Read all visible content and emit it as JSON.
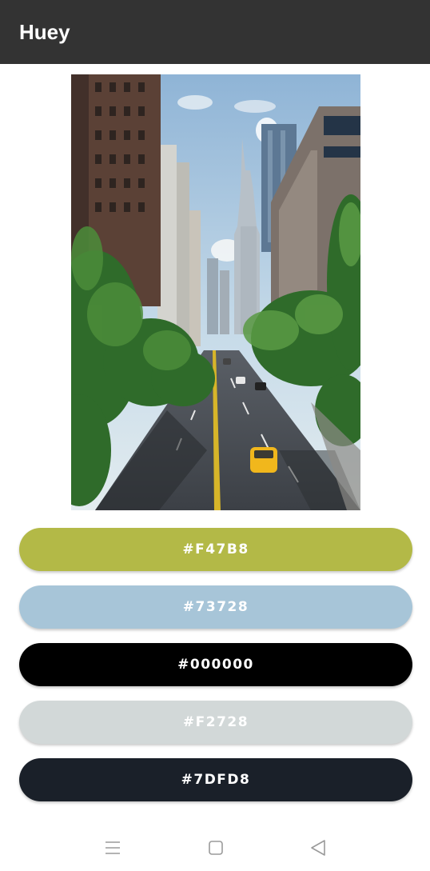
{
  "app": {
    "title": "Huey"
  },
  "swatches": [
    {
      "label": "#F47B8",
      "color": "#b3b947",
      "text_color": "#ffffff"
    },
    {
      "label": "#73728",
      "color": "#a7c5d8",
      "text_color": "#ffffff"
    },
    {
      "label": "#000000",
      "color": "#000000",
      "text_color": "#ffffff"
    },
    {
      "label": "#F2728",
      "color": "#d2d8d8",
      "text_color": "#ffffff"
    },
    {
      "label": "#7DFD8",
      "color": "#1a2029",
      "text_color": "#ffffff"
    }
  ],
  "nav": {
    "icons": [
      "menu-icon",
      "home-square-icon",
      "back-triangle-icon"
    ]
  },
  "colors": {
    "app_bar": "#333333",
    "background": "#ffffff"
  }
}
